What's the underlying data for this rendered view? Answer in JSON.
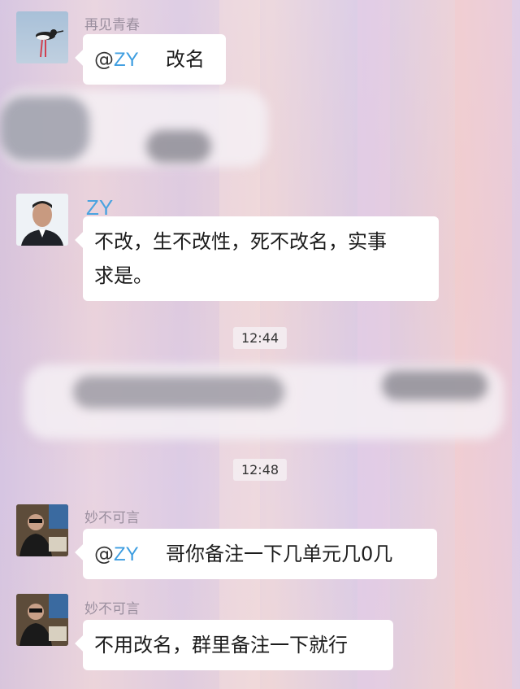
{
  "messages": [
    {
      "sender": "再见青春",
      "mention": "ZY",
      "text": "改名"
    },
    {
      "sender": "ZY",
      "text_line1": "不改，生不改性，死不改名，实事",
      "text_line2": "求是。"
    },
    {
      "sender": "妙不可言",
      "mention": "ZY",
      "text": "哥你备注一下几单元几0几"
    },
    {
      "sender": "妙不可言",
      "text": "不用改名，群里备注一下就行"
    }
  ],
  "timestamps": [
    "12:44",
    "12:48"
  ],
  "icons": {
    "avatar1": "bird-avatar-icon",
    "avatar2": "man-portrait-avatar-icon",
    "avatar3": "person-sunglasses-avatar-icon"
  }
}
